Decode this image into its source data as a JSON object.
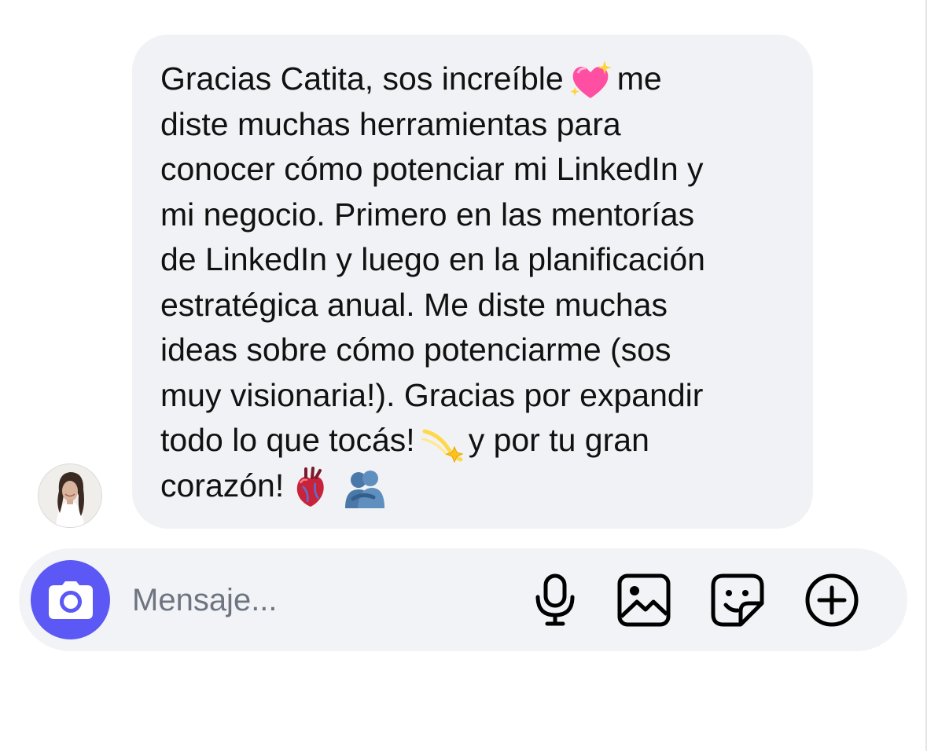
{
  "message": {
    "lines": [
      [
        "Gracias Catita, sos increíble",
        "sparkling-heart-emoji",
        "me"
      ],
      [
        "diste muchas herramientas para"
      ],
      [
        "conocer cómo potenciar mi LinkedIn y"
      ],
      [
        "mi negocio. Primero en las mentorías"
      ],
      [
        "de LinkedIn y luego en la planificación"
      ],
      [
        "estratégica anual. Me diste muchas"
      ],
      [
        "ideas sobre cómo potenciarme (sos"
      ],
      [
        "muy visionaria!). Gracias por expandir"
      ],
      [
        "todo lo que tocás!",
        "dizzy-emoji",
        "y por tu gran"
      ],
      [
        "corazón!",
        "anatomical-heart-emoji",
        "people-hugging-emoji"
      ]
    ],
    "text": {
      "line1a": "Gracias Catita, sos increíble",
      "line1b": "me",
      "line2": "diste muchas herramientas para",
      "line3": "conocer cómo potenciar mi LinkedIn y",
      "line4": "mi negocio. Primero en las mentorías",
      "line5": "de LinkedIn y luego en la planificación",
      "line6": "estratégica anual. Me diste muchas",
      "line7": "ideas sobre cómo potenciarme (sos",
      "line8": "muy visionaria!). Gracias por expandir",
      "line9a": "todo lo que tocás!",
      "line9b": "y por tu gran",
      "line10a": "corazón!"
    }
  },
  "composer": {
    "placeholder": "Mensaje...",
    "value": "",
    "camera_icon": "camera-icon",
    "tools": [
      "microphone-icon",
      "gallery-icon",
      "sticker-icon",
      "add-icon"
    ]
  },
  "colors": {
    "bubble_bg": "#f1f2f5",
    "composer_bg": "#f2f3f6",
    "camera_button": "#5b58f5",
    "text": "#111111",
    "placeholder": "#6e7480"
  }
}
